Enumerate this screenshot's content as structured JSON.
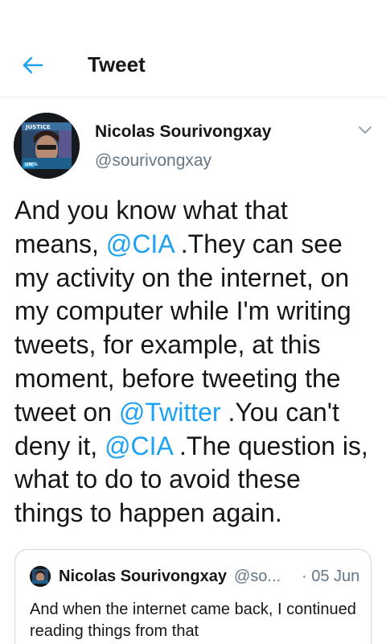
{
  "header": {
    "title": "Tweet",
    "back_icon": "arrow-left-icon",
    "accent_color": "#1da1f2"
  },
  "tweet": {
    "author_name": "Nicolas Sourivongxay",
    "author_handle": "@sourivongxay",
    "avatar_badge_top": "JUSTICE",
    "avatar_badge_bottom": "UN%",
    "menu_icon": "chevron-down-icon",
    "text": {
      "p1": "And you know what that means, ",
      "m1": "@CIA",
      "p2": " .They can see my activity on the internet, on my computer while I'm writing tweets, for example, at this moment, before tweeting the tweet on ",
      "m2": "@Twitter",
      "p3": " .You can't deny it, ",
      "m3": "@CIA",
      "p4": " .The question is, what to do to avoid these things to happen again."
    }
  },
  "quoted_tweet": {
    "author_name": "Nicolas Sourivongxay",
    "author_handle": "@so...",
    "date": "· 05 Jun",
    "text": "And when the internet came back, I continued reading things from that"
  }
}
